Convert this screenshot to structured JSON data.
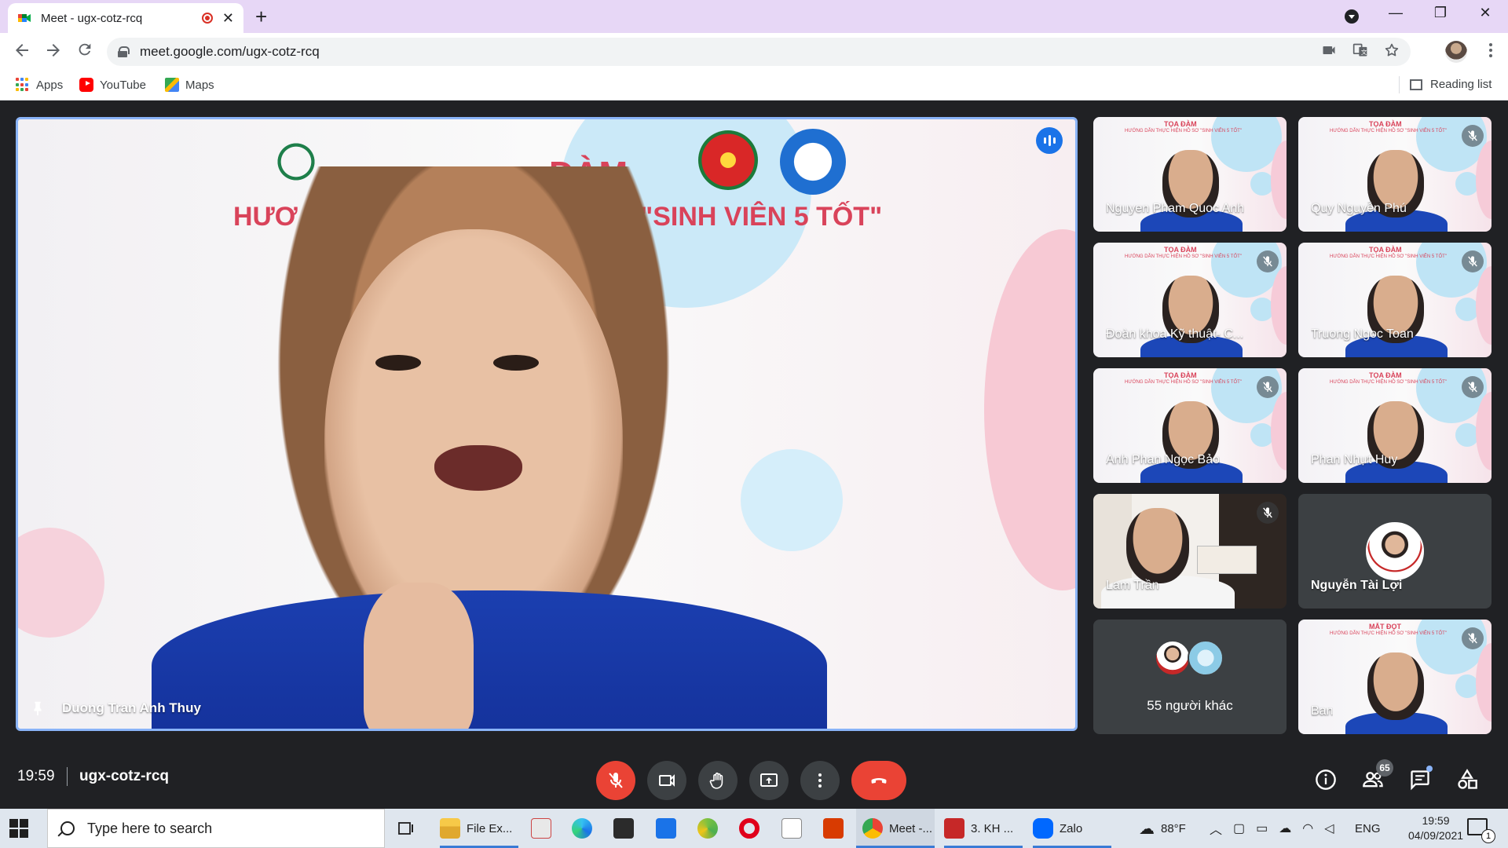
{
  "browser": {
    "tab_title": "Meet - ugx-cotz-rcq",
    "new_tab_label": "+",
    "close_tab_label": "✕",
    "window_controls": {
      "minimize": "—",
      "restore": "❐",
      "close": "✕"
    },
    "url": "meet.google.com/ugx-cotz-rcq",
    "bookmarks": [
      {
        "label": "Apps",
        "icon": "apps-grid-icon"
      },
      {
        "label": "YouTube",
        "icon": "youtube-icon"
      },
      {
        "label": "Maps",
        "icon": "maps-icon"
      }
    ],
    "reading_list": "Reading list"
  },
  "meet": {
    "main_speaker": {
      "name": "Duong Tran Anh Thuy",
      "banner_line1": "ĐÀM",
      "banner_line2_left": "HƯƠ",
      "banner_line2_right": "SƠ \"SINH VIÊN 5 TỐT\"",
      "pinned": true,
      "speaking": true
    },
    "participants": [
      {
        "name": "Nguyen Pham Quoc Anh",
        "muted": false,
        "type": "video"
      },
      {
        "name": "Quy Nguyễn Phú",
        "muted": true,
        "type": "video"
      },
      {
        "name": "Đoàn khoa Kỹ thuật- C...",
        "muted": true,
        "type": "video"
      },
      {
        "name": "Truong Ngoc Toan",
        "muted": true,
        "type": "video"
      },
      {
        "name": "Anh Phan Ngọc Bảo",
        "muted": true,
        "type": "video"
      },
      {
        "name": "Phan Nhựt Huy",
        "muted": true,
        "type": "video"
      },
      {
        "name": "Lam Trần",
        "muted": true,
        "type": "video-room"
      },
      {
        "name": "Nguyễn Tài Lợi",
        "muted": false,
        "type": "avatar"
      },
      {
        "name": "55 người khác",
        "muted": false,
        "type": "others"
      },
      {
        "name": "Ban",
        "muted": true,
        "type": "video"
      }
    ],
    "tile_banner_title": "TỌA ĐÀM",
    "tile_banner_sub": "HƯỚNG DẪN THỰC HIỆN HỒ SƠ \"SINH VIÊN 5 TỐT\"",
    "last_tile_banner_title": "MẮT ĐỌT",
    "bottom_bar": {
      "time": "19:59",
      "meeting_code": "ugx-cotz-rcq",
      "people_count": "65"
    },
    "colors": {
      "background": "#202124",
      "tile": "#3c4043",
      "end_call": "#ea4335",
      "active_speaker_border": "#8ab4f8"
    }
  },
  "taskbar": {
    "search_placeholder": "Type here to search",
    "apps": [
      {
        "label": "File Ex..."
      },
      {
        "label": "Meet -..."
      },
      {
        "label": "3. KH ..."
      },
      {
        "label": "Zalo"
      }
    ],
    "weather": "88°F",
    "language": "ENG",
    "clock_time": "19:59",
    "clock_date": "04/09/2021",
    "notification_count": "1"
  }
}
